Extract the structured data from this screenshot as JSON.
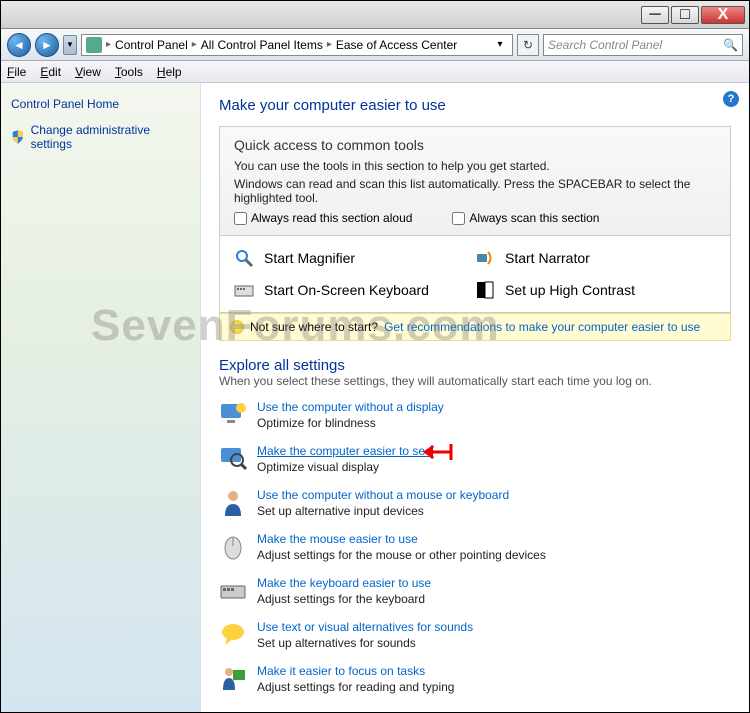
{
  "titlebar": {
    "min": "─",
    "max": "□",
    "close": "X"
  },
  "nav": {
    "back": "◄",
    "fwd": "►",
    "drop": "▼",
    "refresh": "↻"
  },
  "breadcrumb": {
    "b1": "Control Panel",
    "b2": "All Control Panel Items",
    "b3": "Ease of Access Center",
    "sep": "▸",
    "drop": "▾"
  },
  "search": {
    "placeholder": "Search Control Panel",
    "icon": "🔍"
  },
  "menu": {
    "file": "File",
    "edit": "Edit",
    "view": "View",
    "tools": "Tools",
    "help": "Help"
  },
  "sidebar": {
    "home": "Control Panel Home",
    "admin": "Change administrative settings"
  },
  "main": {
    "title": "Make your computer easier to use",
    "panel": {
      "heading": "Quick access to common tools",
      "p1": "You can use the tools in this section to help you get started.",
      "p2": "Windows can read and scan this list automatically.  Press the SPACEBAR to select the highlighted tool.",
      "chk1": "Always read this section aloud",
      "chk2": "Always scan this section"
    },
    "quick": {
      "magnifier": "Start Magnifier",
      "narrator": "Start Narrator",
      "osk": "Start On-Screen Keyboard",
      "contrast": "Set up High Contrast"
    },
    "yellow": {
      "q": "Not sure where to start?",
      "link": "Get recommendations to make your computer easier to use"
    },
    "explore": "Explore all settings",
    "exploresub": "When you select these settings, they will automatically start each time you log on.",
    "settings": [
      {
        "title": "Use the computer without a display",
        "sub": "Optimize for blindness"
      },
      {
        "title": "Make the computer easier to see",
        "sub": "Optimize visual display",
        "hl": true
      },
      {
        "title": "Use the computer without a mouse or keyboard",
        "sub": "Set up alternative input devices"
      },
      {
        "title": "Make the mouse easier to use",
        "sub": "Adjust settings for the mouse or other pointing devices"
      },
      {
        "title": "Make the keyboard easier to use",
        "sub": "Adjust settings for the keyboard"
      },
      {
        "title": "Use text or visual alternatives for sounds",
        "sub": "Set up alternatives for sounds"
      },
      {
        "title": "Make it easier to focus on tasks",
        "sub": "Adjust settings for reading and typing"
      }
    ]
  },
  "watermark": "SevenForums.com",
  "help": "?"
}
